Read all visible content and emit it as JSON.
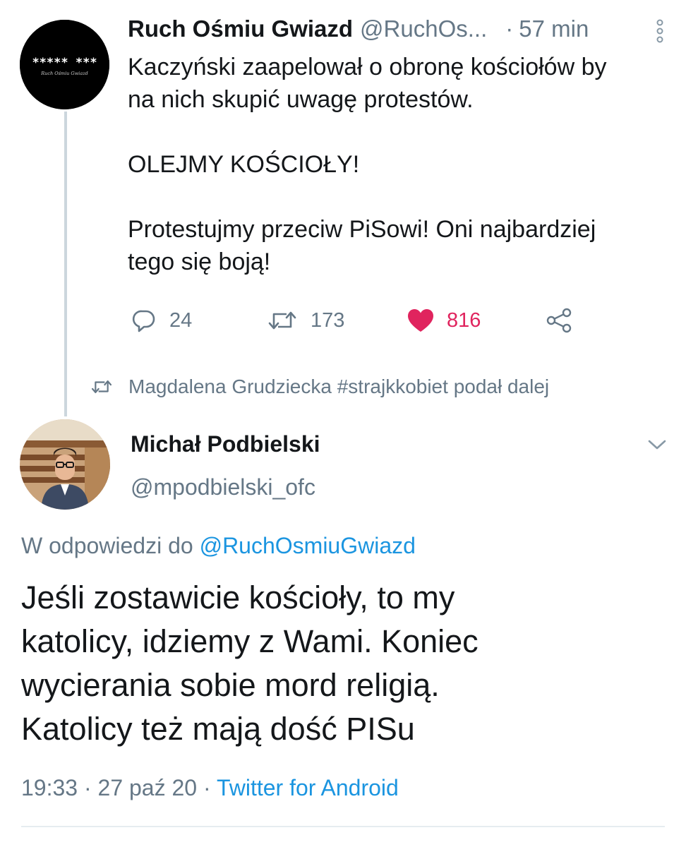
{
  "parent_tweet": {
    "avatar_logo_text": "***** ***",
    "avatar_logo_subtext": "Ruch Ośmiu Gwiazd",
    "name": "Ruch Ośmiu Gwiazd",
    "handle": "@RuchOs...",
    "separator": "·",
    "time": "57 min",
    "text_lines": [
      "Kaczyński zaapelował o obronę kościołów by",
      "na nich skupić uwagę protestów.",
      "",
      "OLEJMY KOŚCIOŁY!",
      "",
      "Protestujmy przeciw PiSowi! Oni najbardziej",
      "tego się boją!"
    ],
    "actions": {
      "reply_count": "24",
      "retweet_count": "173",
      "like_count": "816"
    },
    "icons": {
      "more": "more-vertical-icon",
      "reply": "reply-icon",
      "retweet": "retweet-icon",
      "like": "heart-icon",
      "share": "share-icon"
    }
  },
  "retweet_context": {
    "text": "Magdalena Grudziecka #strajkkobiet podał dalej"
  },
  "main_tweet": {
    "name": "Michał Podbielski",
    "handle": "@mpodbielski_ofc",
    "reply_prefix": "W odpowiedzi do ",
    "reply_mention": "@RuchOsmiuGwiazd",
    "text_lines": [
      "Jeśli zostawicie kościoły, to my",
      "katolicy, idziemy z Wami. Koniec",
      "wycierania sobie mord religią.",
      "Katolicy też mają dość PISu"
    ],
    "time": "19:33",
    "sep": " · ",
    "date": "27 paź 20",
    "source": "Twitter for Android"
  },
  "colors": {
    "text_primary": "#14171a",
    "text_secondary": "#657786",
    "link": "#1b95e0",
    "like": "#e0245e",
    "thread_line": "#ccd6dd"
  }
}
